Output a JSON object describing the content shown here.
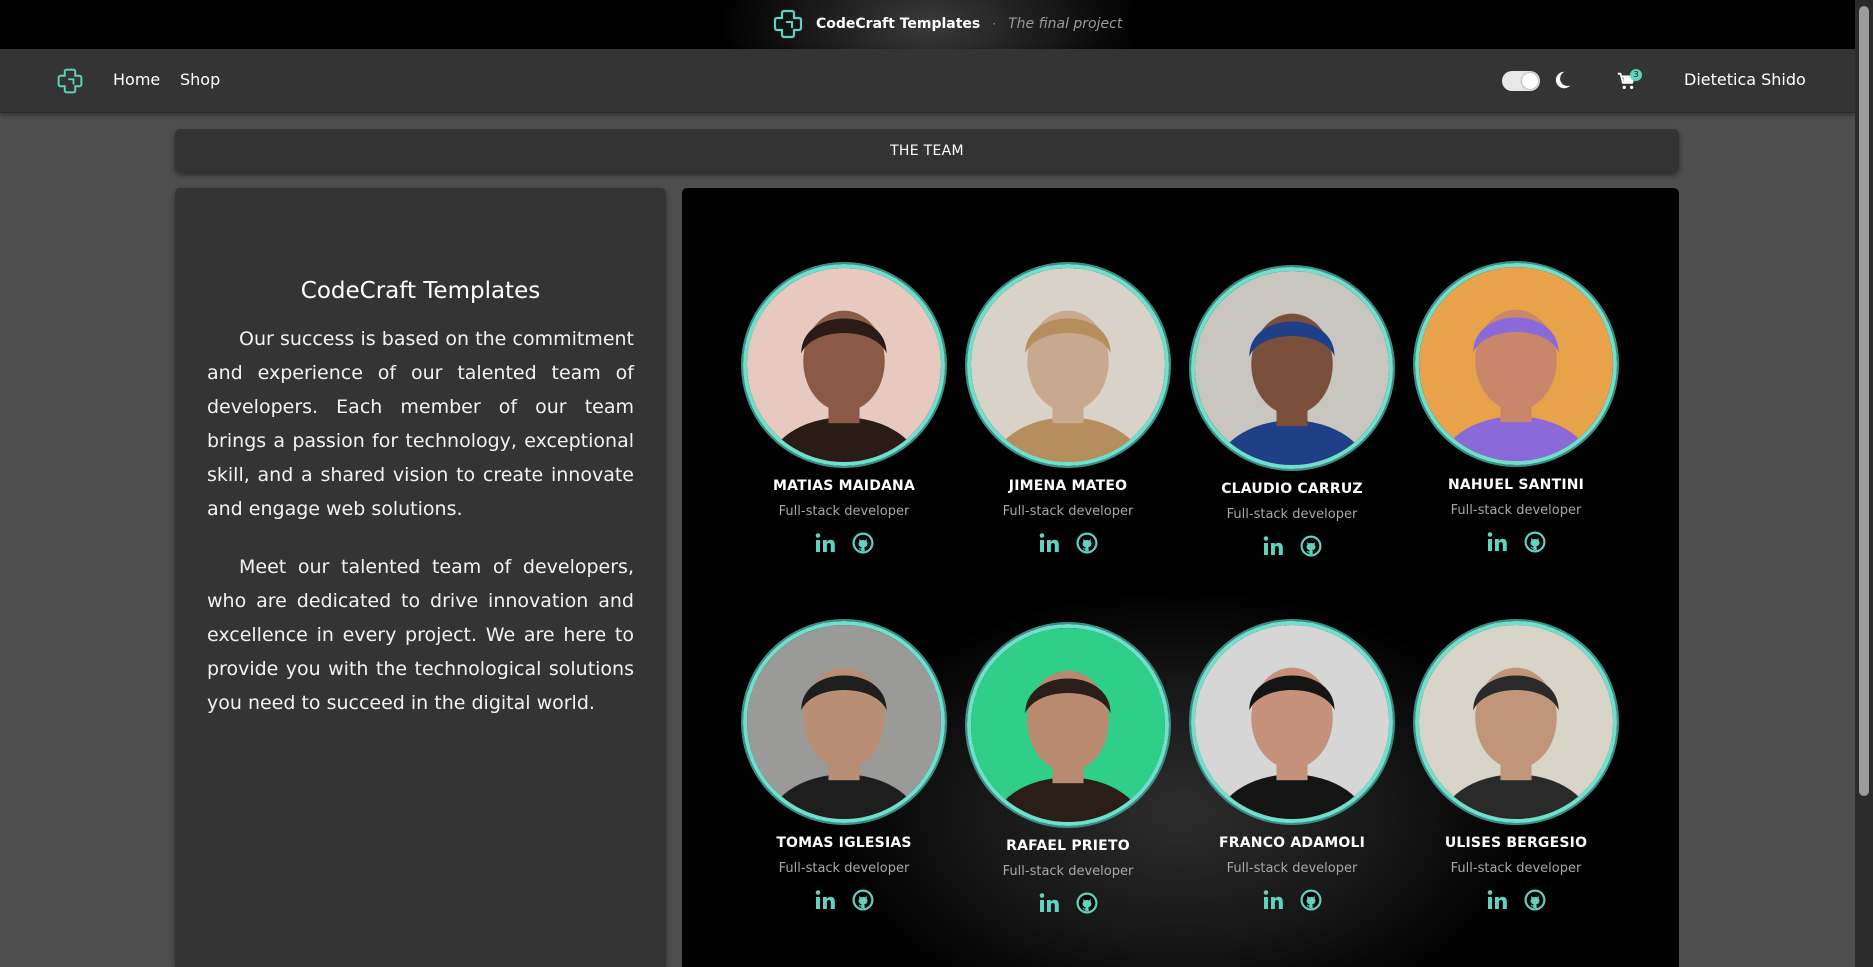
{
  "brand": {
    "name": "CodeCraft Templates",
    "separator": "·",
    "tagline": "The final project"
  },
  "nav": {
    "home": "Home",
    "shop": "Shop",
    "cart_count": "3",
    "user": "Dietetica Shido"
  },
  "section": {
    "title": "THE TEAM"
  },
  "about": {
    "title": "CodeCraft Templates",
    "p1": "Our success is based on the commitment and experience of our talented team of developers. Each member of our team brings a passion for technology, exceptional skill, and a shared vision to create innovate and engage web solutions.",
    "p2": "Meet our talented team of developers, who are dedicated to drive innovation and excellence in every project. We are here to provide you with the technological solutions you need to succeed in the digital world."
  },
  "team": [
    {
      "name": "MATIAS MAIDANA",
      "role": "Full-stack developer"
    },
    {
      "name": "JIMENA MATEO",
      "role": "Full-stack developer"
    },
    {
      "name": "CLAUDIO CARRUZ",
      "role": "Full-stack developer"
    },
    {
      "name": "NAHUEL SANTINI",
      "role": "Full-stack developer"
    },
    {
      "name": "TOMAS IGLESIAS",
      "role": "Full-stack developer"
    },
    {
      "name": "RAFAEL PRIETO",
      "role": "Full-stack developer"
    },
    {
      "name": "FRANCO ADAMOLI",
      "role": "Full-stack developer"
    },
    {
      "name": "ULISES BERGESIO",
      "role": "Full-stack developer"
    }
  ],
  "icons": {
    "logo": "cross-logo-icon",
    "theme": "moon-icon",
    "cart": "cart-icon",
    "social": [
      "linkedin-icon",
      "github-icon"
    ]
  },
  "colors": {
    "accent": "#5fd3c0",
    "navbar": "#343434",
    "page": "#4e4e4e",
    "panel": "#343434"
  }
}
